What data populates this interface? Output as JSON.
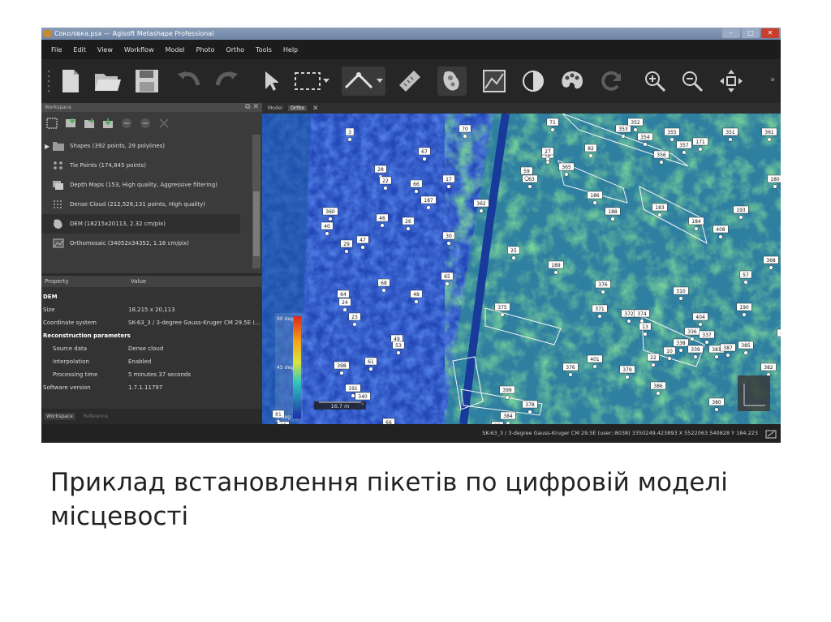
{
  "window": {
    "title": "Соколівка.psx — Agisoft Metashape Professional"
  },
  "menu": [
    "File",
    "Edit",
    "View",
    "Workflow",
    "Model",
    "Photo",
    "Ortho",
    "Tools",
    "Help"
  ],
  "workspace": {
    "title": "Workspace",
    "items": [
      {
        "label": "Shapes (392 points, 29 polylines)",
        "icon": "folder-icon"
      },
      {
        "label": "Tie Points (174,845 points)",
        "icon": "points-icon"
      },
      {
        "label": "Depth Maps (153, High quality, Aggressive filtering)",
        "icon": "depth-maps-icon"
      },
      {
        "label": "Dense Cloud (212,526,131 points, High quality)",
        "icon": "dense-cloud-icon"
      },
      {
        "label": "DEM (18215x20113, 2.32 cm/pix)",
        "icon": "dem-icon"
      },
      {
        "label": "Orthomosaic (34052x34352, 1.16 cm/pix)",
        "icon": "orthomosaic-icon"
      }
    ]
  },
  "properties": {
    "col_property": "Property",
    "col_value": "Value",
    "rows": [
      {
        "key": "DEM",
        "value": "",
        "group": true
      },
      {
        "key": "Size",
        "value": "18,215 x 20,113"
      },
      {
        "key": "Coordinate system",
        "value": "SK-63_3 / 3-degree Gauss-Kruger CM 29.5E (..."
      },
      {
        "key": "Reconstruction parameters",
        "value": "",
        "group": true
      },
      {
        "key": "Source data",
        "value": "Dense cloud",
        "indent": true
      },
      {
        "key": "Interpolation",
        "value": "Enabled",
        "indent": true
      },
      {
        "key": "Processing time",
        "value": "5 minutes 37 seconds",
        "indent": true
      },
      {
        "key": "Software version",
        "value": "1.7.1.11797"
      }
    ]
  },
  "bottom_tabs": [
    "Workspace",
    "Reference"
  ],
  "doc_tabs": [
    "Model",
    "Ortho"
  ],
  "ortho": {
    "legend": {
      "max": "90 deg",
      "mid": "45 deg",
      "min": "0 deg"
    },
    "scale_label": "16.7 m"
  },
  "pickets": [
    "3",
    "28",
    "67",
    "70",
    "71",
    "72",
    "82",
    "353",
    "352",
    "354",
    "355",
    "356",
    "357",
    "171",
    "351",
    "361",
    "360",
    "22",
    "17",
    "187",
    "362",
    "363",
    "365",
    "186",
    "188",
    "183",
    "184",
    "408",
    "193",
    "180",
    "368",
    "40",
    "29",
    "30",
    "59",
    "27",
    "66",
    "46",
    "26",
    "47",
    "65",
    "25",
    "189",
    "68",
    "48",
    "64",
    "371",
    "372",
    "374",
    "375",
    "376",
    "310",
    "57",
    "190",
    "409",
    "24",
    "23",
    "49",
    "61",
    "53",
    "398",
    "399",
    "401",
    "404",
    "336",
    "337",
    "338",
    "339",
    "22",
    "13",
    "10",
    "381",
    "387",
    "385",
    "376",
    "379",
    "386",
    "380",
    "382",
    "378",
    "384",
    "191",
    "340",
    "81",
    "85",
    "66",
    "11",
    "11",
    "12",
    "36"
  ],
  "status": {
    "text": "SK-63_3 / 3-degree Gauss-Kruger CM 29.5E (user::8038)   3350249.423893 X   5522063.540828 Y   184.223"
  },
  "caption": "Приклад встановлення пікетів по цифровій моделі місцевості",
  "colors": {
    "background_dark": "#2a2a2a",
    "dem_blue": "#1f3fb0",
    "dem_green": "#2f9e50"
  }
}
